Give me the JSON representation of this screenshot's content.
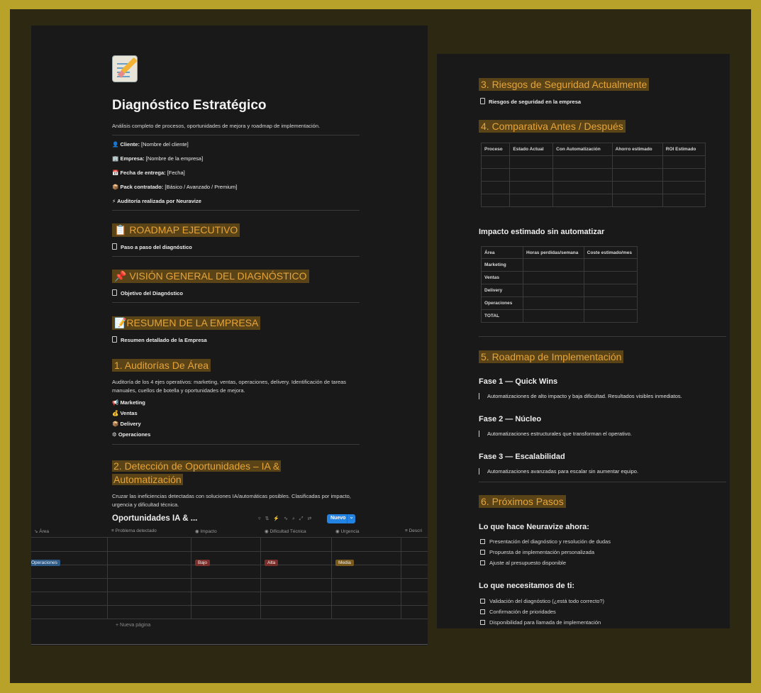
{
  "left": {
    "title": "Diagnóstico Estratégico",
    "subtitle": "Análisis completo de procesos, oportunidades de mejora y roadmap de implementación.",
    "props": [
      {
        "icon": "👤",
        "label": "Cliente:",
        "value": "[Nombre del cliente]"
      },
      {
        "icon": "🏢",
        "label": "Empresa:",
        "value": "[Nombre de la empresa]"
      },
      {
        "icon": "📅",
        "label": "Fecha de entrega:",
        "value": "[Fecha]"
      },
      {
        "icon": "📦",
        "label": "Pack contratado:",
        "value": "[Básico / Avanzado / Premium]"
      },
      {
        "icon": "⚡",
        "label": "Auditoría realizada por Neuravize",
        "value": ""
      }
    ],
    "roadmap": {
      "heading": "📋 ROADMAP EJECUTIVO",
      "link": "Paso a paso del diagnóstico"
    },
    "vision": {
      "heading": "📌 VISIÓN GENERAL DEL DIAGNÓSTICO",
      "link": "Objetivo del Diagnóstico"
    },
    "resumen": {
      "heading": "📝RESUMEN DE LA EMPRESA",
      "link": "Resumen detallado de la Empresa"
    },
    "auditorias": {
      "heading": "1. Auditorías De Área",
      "desc": "Auditoría de los 4 ejes operativos: marketing, ventas, operaciones, delivery. Identificación de tareas manuales, cuellos de botella y oportunidades de mejora.",
      "items": [
        {
          "icon": "📢",
          "label": "Marketing"
        },
        {
          "icon": "💰",
          "label": "Ventas"
        },
        {
          "icon": "📦",
          "label": "Delivery"
        },
        {
          "icon": "⚙",
          "label": "Operaciones"
        }
      ]
    },
    "deteccion": {
      "heading_line1": "2. Detección de Oportunidades – IA &",
      "heading_line2": "Automatización",
      "desc": "Cruzar las ineficiencias detectadas con soluciones IA/automáticas posibles. Clasificadas por impacto, urgencia y dificultad técnica."
    },
    "database": {
      "title": "Oportunidades IA & ...",
      "new_button": "Nuevo",
      "columns": [
        "Área",
        "Problema detectado",
        "Impacto",
        "Dificultad Técnica",
        "Urgencia",
        "Descri"
      ],
      "row": {
        "area": "Operaciones",
        "impacto": "Bajo",
        "dificultad": "Alta",
        "urgencia": "Media"
      },
      "new_page": "Nueva página"
    }
  },
  "right": {
    "riesgos": {
      "heading": "3. Riesgos de Seguridad Actualmente",
      "link": "Riesgos de seguridad en la empresa"
    },
    "comparativa": {
      "heading": "4. Comparativa Antes / Después",
      "columns": [
        "Proceso",
        "Estado Actual",
        "Con Automatización",
        "Ahorro estimado",
        "ROI Estimado"
      ]
    },
    "impacto": {
      "title": "Impacto estimado sin automatizar",
      "columns": [
        "Área",
        "Horas perdidas/semana",
        "Coste estimado/mes"
      ],
      "rows": [
        "Marketing",
        "Ventas",
        "Delivery",
        "Operaciones",
        "TOTAL"
      ]
    },
    "roadmap": {
      "heading": "5. Roadmap de Implementación",
      "phases": [
        {
          "title": "Fase 1 — Quick Wins",
          "text": "Automatizaciones de alto impacto y baja dificultad. Resultados visibles inmediatos."
        },
        {
          "title": "Fase 2 — Núcleo",
          "text": "Automatizaciones estructurales que transforman el operativo."
        },
        {
          "title": "Fase 3 — Escalabilidad",
          "text": "Automatizaciones avanzadas para escalar sin aumentar equipo."
        }
      ]
    },
    "proximos": {
      "heading": "6. Próximos Pasos",
      "neuravize_title": "Lo que hace Neuravize ahora:",
      "neuravize_items": [
        "Presentación del diagnóstico y resolución de dudas",
        "Propuesta de implementación personalizada",
        "Ajuste al presupuesto disponible"
      ],
      "ti_title": "Lo que necesitamos de ti:",
      "ti_items": [
        "Validación del diagnóstico (¿está todo correcto?)",
        "Confirmación de prioridades",
        "Disponibilidad para llamada de implementación"
      ]
    }
  },
  "colors": {
    "accent": "#e6a43a",
    "highlight_bg": "#5a4316",
    "frame": "#b8a22a",
    "page_bg": "#191919",
    "tag_blue": "#2e5a86",
    "tag_red": "#7a2e2a",
    "tag_gold": "#7a5a1c",
    "button_blue": "#2383e2"
  }
}
